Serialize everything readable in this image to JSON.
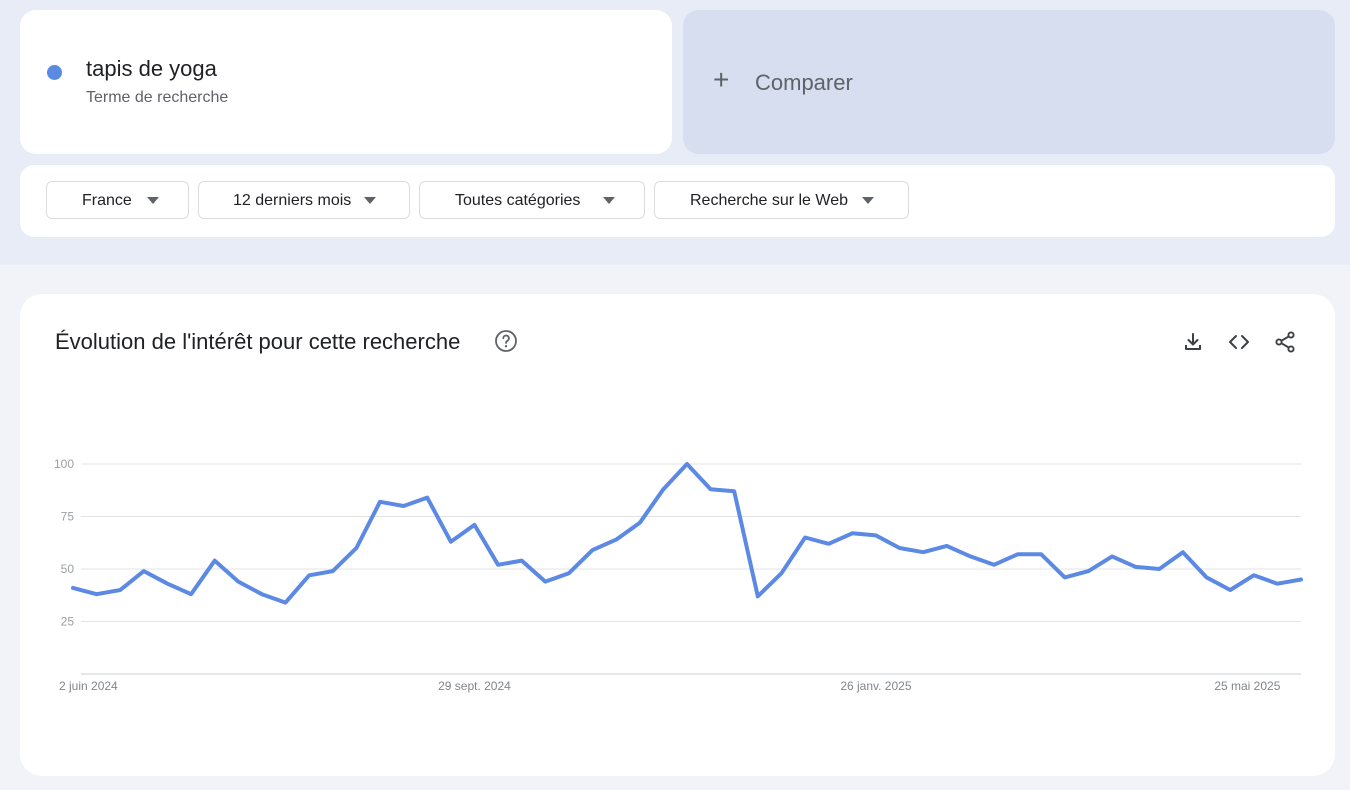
{
  "colors": {
    "series": "#5b89e3",
    "accent_card": "#d6def0",
    "grid": "#e3e3e3"
  },
  "search_term": {
    "name": "tapis de yoga",
    "subtitle": "Terme de recherche"
  },
  "compare": {
    "icon": "plus-icon",
    "label": "Comparer"
  },
  "filters": [
    {
      "label": "France"
    },
    {
      "label": "12 derniers mois"
    },
    {
      "label": "Toutes catégories"
    },
    {
      "label": "Recherche sur le Web"
    }
  ],
  "chart_header": {
    "title": "Évolution de l'intérêt pour cette recherche",
    "help_icon": "help-circle-icon",
    "actions": [
      "download-icon",
      "embed-code-icon",
      "share-icon"
    ]
  },
  "chart_data": {
    "type": "line",
    "title": "Évolution de l'intérêt pour cette recherche",
    "xlabel": "",
    "ylabel": "",
    "ylim": [
      0,
      100
    ],
    "y_ticks": [
      25,
      50,
      75,
      100
    ],
    "x_tick_labels": [
      "2 juin 2024",
      "29 sept. 2024",
      "26 janv. 2025",
      "25 mai 2025"
    ],
    "x_tick_indices": [
      0,
      17,
      34,
      51
    ],
    "grid": true,
    "series": [
      {
        "values": [
          41,
          38,
          40,
          49,
          43,
          38,
          54,
          44,
          38,
          34,
          47,
          49,
          60,
          82,
          80,
          84,
          63,
          71,
          52,
          54,
          44,
          48,
          59,
          64,
          72,
          88,
          100,
          88,
          87,
          37,
          48,
          65,
          62,
          67,
          66,
          60,
          58,
          61,
          56,
          52,
          57,
          57,
          46,
          49,
          56,
          51,
          50,
          58,
          46,
          40,
          47,
          43,
          45
        ]
      }
    ]
  }
}
